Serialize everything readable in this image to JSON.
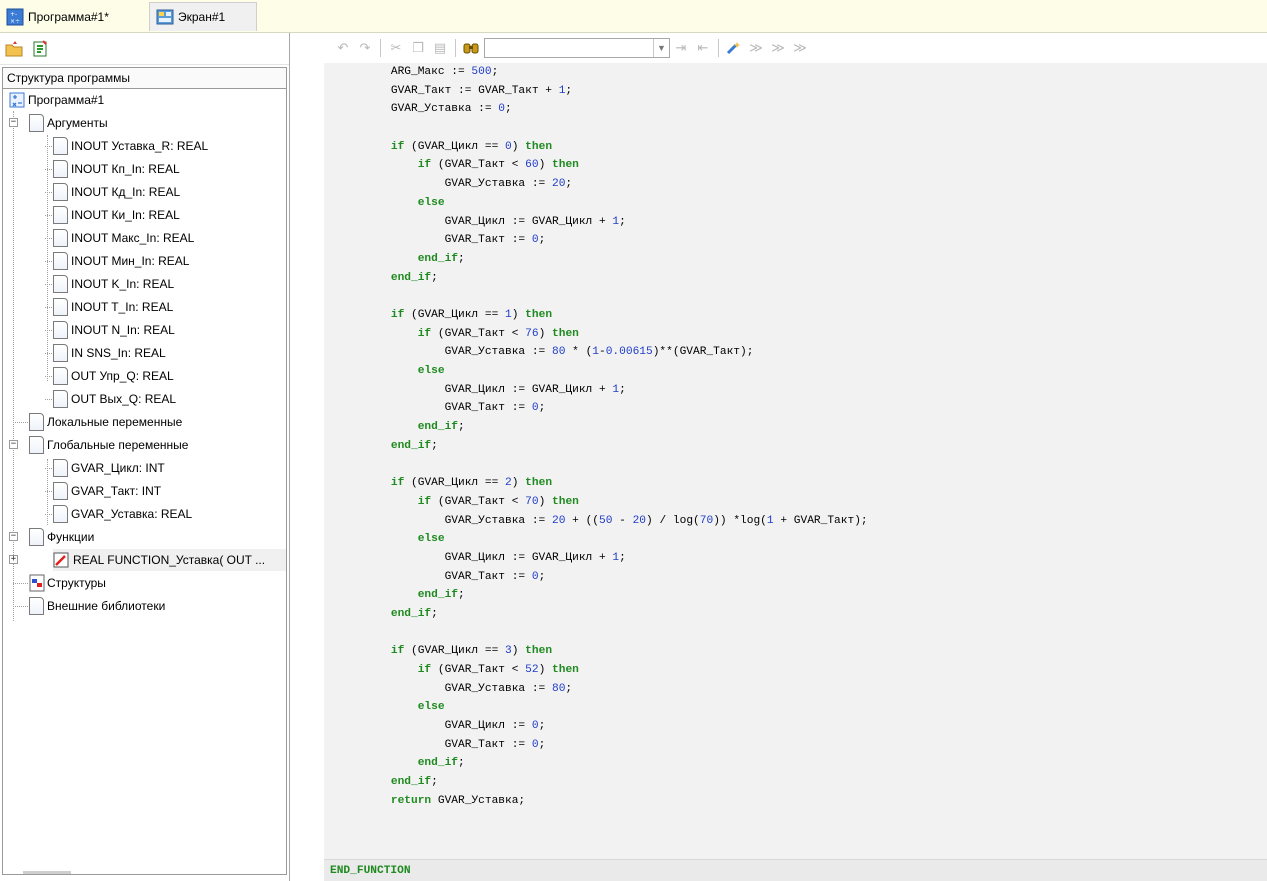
{
  "tabs": [
    {
      "label": "Программа#1*",
      "icon": "program-icon",
      "active": true
    },
    {
      "label": "Экран#1",
      "icon": "screen-icon",
      "active": false
    }
  ],
  "left_toolbar": [
    {
      "name": "open-folder-icon"
    },
    {
      "name": "new-item-icon"
    }
  ],
  "panel_title": "Структура программы",
  "tree": {
    "root": "Программа#1",
    "arguments_label": "Аргументы",
    "arguments": [
      "INOUT Уставка_R: REAL",
      "INOUT Кп_In: REAL",
      "INOUT Кд_In: REAL",
      "INOUT Ки_In: REAL",
      "INOUT Макс_In: REAL",
      "INOUT Мин_In: REAL",
      "INOUT K_In: REAL",
      "INOUT T_In: REAL",
      "INOUT N_In: REAL",
      "IN SNS_In: REAL",
      "OUT Упр_Q: REAL",
      "OUT Вых_Q: REAL"
    ],
    "locals_label": "Локальные переменные",
    "globals_label": "Глобальные переменные",
    "globals": [
      "GVAR_Цикл: INT",
      "GVAR_Такт: INT",
      "GVAR_Уставка: REAL"
    ],
    "functions_label": "Функции",
    "function_item": "REAL FUNCTION_Уставка( OUT ...",
    "structures_label": "Структуры",
    "external_libs_label": "Внешние библиотеки"
  },
  "editor_toolbar": {
    "find_value": "",
    "buttons": [
      "undo-icon",
      "redo-icon",
      "cut-icon",
      "copy-icon",
      "paste-icon",
      "find-icon",
      "indent-icon",
      "unindent-icon",
      "bookmark-toggle-icon",
      "bookmark-next-icon",
      "bookmark-prev-icon",
      "bookmark-clear-icon"
    ]
  },
  "code": [
    "    ARG_Макс := 500;",
    "    GVAR_Такт := GVAR_Такт + 1;",
    "    GVAR_Уставка := 0;",
    "",
    "    if (GVAR_Цикл == 0) then",
    "        if (GVAR_Такт < 60) then",
    "            GVAR_Уставка := 20;",
    "        else",
    "            GVAR_Цикл := GVAR_Цикл + 1;",
    "            GVAR_Такт := 0;",
    "        end_if;",
    "    end_if;",
    "",
    "    if (GVAR_Цикл == 1) then",
    "        if (GVAR_Такт < 76) then",
    "            GVAR_Уставка := 80 * (1-0.00615)**(GVAR_Такт);",
    "        else",
    "            GVAR_Цикл := GVAR_Цикл + 1;",
    "            GVAR_Такт := 0;",
    "        end_if;",
    "    end_if;",
    "",
    "    if (GVAR_Цикл == 2) then",
    "        if (GVAR_Такт < 70) then",
    "            GVAR_Уставка := 20 + ((50 - 20) / log(70)) *log(1 + GVAR_Такт);",
    "        else",
    "            GVAR_Цикл := GVAR_Цикл + 1;",
    "            GVAR_Такт := 0;",
    "        end_if;",
    "    end_if;",
    "",
    "    if (GVAR_Цикл == 3) then",
    "        if (GVAR_Такт < 52) then",
    "            GVAR_Уставка := 80;",
    "        else",
    "            GVAR_Цикл := 0;",
    "            GVAR_Такт := 0;",
    "        end_if;",
    "    end_if;",
    "    return GVAR_Уставка;"
  ],
  "end_function": "END_FUNCTION",
  "colors": {
    "keyword": "#1f8a1f",
    "number": "#1f3cc8",
    "tab_strip": "#fdfde8",
    "code_bg": "#f2f2f2"
  }
}
